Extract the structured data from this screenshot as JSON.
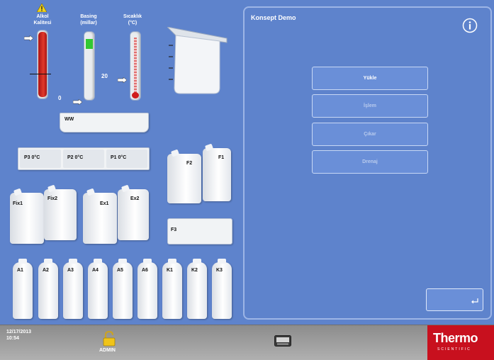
{
  "gauges": {
    "alcohol_label": "Alkol\nKalitesi",
    "pressure_label": "Basing\n(millar)",
    "temp_label": "Sıcaklık\n(°C)",
    "pressure_min": "0",
    "pressure_value": "20"
  },
  "retort": {
    "label": "WW"
  },
  "wax_baths": [
    {
      "label": "P3  0°C"
    },
    {
      "label": "P2  0°C"
    },
    {
      "label": "P1  0°C"
    }
  ],
  "containers": {
    "f2": "F2",
    "f1": "F1",
    "f3": "F3",
    "fix1": "Fix1",
    "fix2": "Fix2",
    "ex1": "Ex1",
    "ex2": "Ex2"
  },
  "reagent_bottles": [
    "A1",
    "A2",
    "A3",
    "A4",
    "A5",
    "A6",
    "K1",
    "K2",
    "K3"
  ],
  "panel": {
    "title": "Konsept Demo",
    "buttons": [
      "Yükle",
      "İşlem",
      "Çıkar",
      "Drenaj"
    ],
    "back_icon": "return-arrow-icon",
    "info_icon": "info-icon"
  },
  "footer": {
    "date": "12/17/2013",
    "time": "10:54",
    "user": "ADMIN",
    "brand_top": "Thermo",
    "brand_bottom": "SCIENTIFIC"
  }
}
